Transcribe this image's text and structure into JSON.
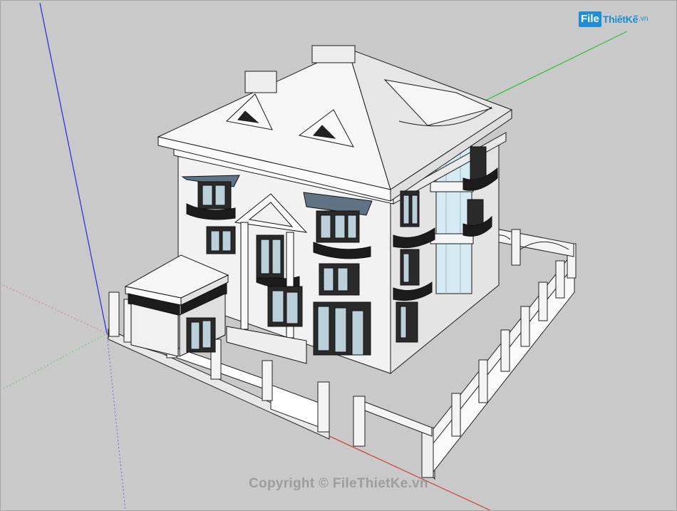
{
  "logo": {
    "badge": "File",
    "name": "ThiếtKế",
    "suffix": ".vn"
  },
  "watermark": {
    "text": "Copyright © FileThietKe.vn"
  },
  "axes": {
    "x_color": "#d23a3a",
    "y_color": "#2fbf3a",
    "z_color": "#2a2ad4"
  },
  "colors": {
    "background": "#c9c9c9",
    "wall": "#f2f2f2",
    "roof": "#ededed",
    "dark_trim": "#1c1c1c",
    "glass": "#cfe8f2",
    "awning": "#5f7384",
    "brand": "#1e8fd6"
  }
}
